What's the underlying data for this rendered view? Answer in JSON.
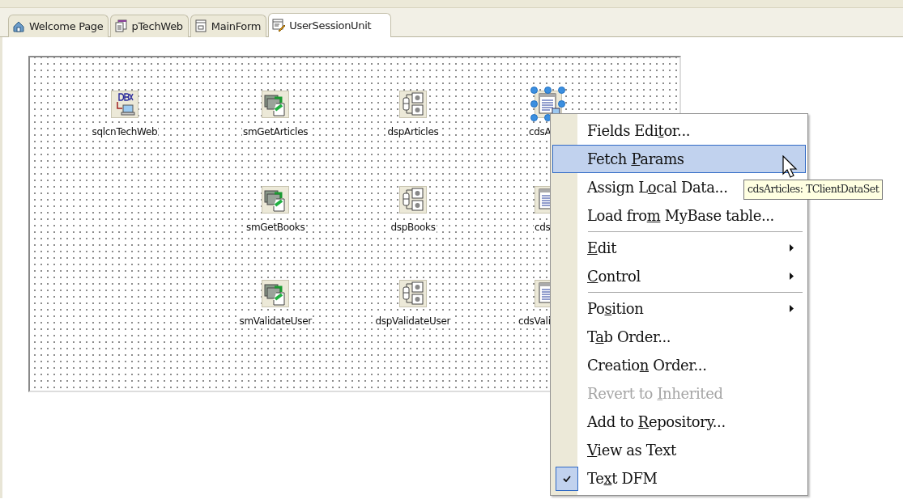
{
  "tabs": [
    {
      "label": "Welcome Page",
      "selected": false
    },
    {
      "label": "pTechWeb",
      "selected": false
    },
    {
      "label": "MainForm",
      "selected": false
    },
    {
      "label": "UserSessionUnit",
      "selected": true
    }
  ],
  "components": [
    {
      "label": "sqlcnTechWeb",
      "kind": "dbx",
      "selected": false
    },
    {
      "label": "smGetArticles",
      "kind": "remote",
      "selected": false
    },
    {
      "label": "dspArticles",
      "kind": "provider",
      "selected": false
    },
    {
      "label": "cdsA",
      "kind": "dataset",
      "selected": true
    },
    {
      "label": "smGetBooks",
      "kind": "remote",
      "selected": false
    },
    {
      "label": "dspBooks",
      "kind": "provider",
      "selected": false
    },
    {
      "label": "cds",
      "kind": "dataset",
      "selected": false
    },
    {
      "label": "smValidateUser",
      "kind": "remote",
      "selected": false
    },
    {
      "label": "dspValidateUser",
      "kind": "provider",
      "selected": false
    },
    {
      "label": "cdsVali",
      "kind": "dataset",
      "selected": false
    }
  ],
  "context_menu": {
    "items": [
      {
        "kind": "item",
        "text": "Fields Edi",
        "key": "t",
        "rest": "or...",
        "selected": false,
        "disabled": false,
        "submenu": false,
        "checked": false
      },
      {
        "kind": "item",
        "text": "Fetch ",
        "key": "P",
        "rest": "arams",
        "selected": true,
        "disabled": false,
        "submenu": false,
        "checked": false
      },
      {
        "kind": "item",
        "text": "Assign L",
        "key": "o",
        "rest": "cal Data...",
        "selected": false,
        "disabled": false,
        "checked": false
      },
      {
        "kind": "item",
        "text": "Load fro",
        "key": "m",
        "rest": " MyBase table...",
        "selected": false,
        "disabled": false,
        "submenu": false,
        "checked": false
      },
      {
        "kind": "separator"
      },
      {
        "kind": "item",
        "key": "E",
        "rest": "dit",
        "selected": false,
        "disabled": false,
        "submenu": true,
        "checked": false
      },
      {
        "kind": "item",
        "key": "C",
        "rest": "ontrol",
        "selected": false,
        "disabled": false,
        "submenu": true,
        "checked": false
      },
      {
        "kind": "separator"
      },
      {
        "kind": "item",
        "text": "Po",
        "key": "s",
        "rest": "ition",
        "selected": false,
        "disabled": false,
        "submenu": true,
        "checked": false
      },
      {
        "kind": "item",
        "text": "T",
        "key": "a",
        "rest": "b Order...",
        "selected": false,
        "disabled": false,
        "submenu": false,
        "checked": false
      },
      {
        "kind": "item",
        "text": "Creatio",
        "key": "n",
        "rest": " Order...",
        "selected": false,
        "disabled": false,
        "submenu": false,
        "checked": false
      },
      {
        "kind": "item",
        "text": "Revert to ",
        "key": "I",
        "rest": "nherited",
        "selected": false,
        "disabled": true,
        "submenu": false,
        "checked": false
      },
      {
        "kind": "item",
        "text": "Add to ",
        "key": "R",
        "rest": "epository...",
        "selected": false,
        "disabled": false,
        "submenu": false,
        "checked": false
      },
      {
        "kind": "item",
        "key": "V",
        "rest": "iew as Text",
        "selected": false,
        "disabled": false,
        "submenu": false,
        "checked": false
      },
      {
        "kind": "item",
        "text": "Te",
        "key": "x",
        "rest": "t DFM",
        "selected": false,
        "disabled": false,
        "submenu": false,
        "checked": true
      }
    ]
  },
  "tooltip": "cdsArticles: TClientDataSet"
}
